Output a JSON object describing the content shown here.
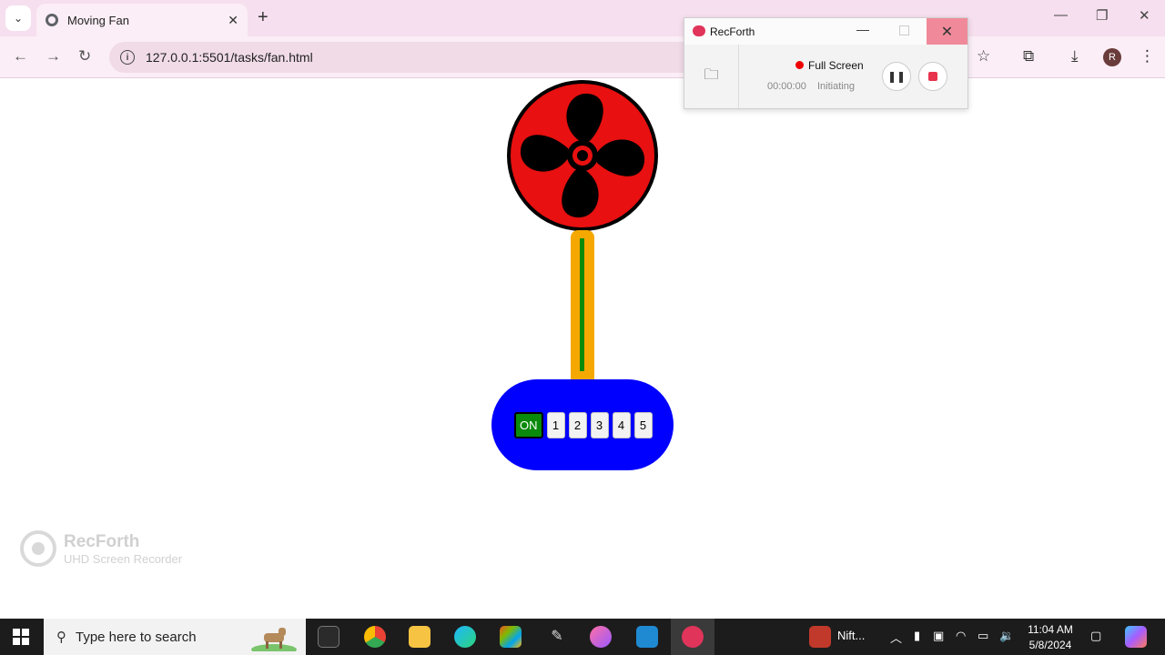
{
  "browser": {
    "tab_title": "Moving Fan",
    "url": "127.0.0.1:5501/tasks/fan.html",
    "profile_initial": "R"
  },
  "fan": {
    "buttons": [
      "ON",
      "1",
      "2",
      "3",
      "4",
      "5"
    ],
    "colors": {
      "blade_bg": "#e81010",
      "pole": "#f5a800",
      "pole_line": "#0a8a0a",
      "base": "#0000ff",
      "on_button": "#0a8a0a"
    }
  },
  "watermark": {
    "brand": "RecForth",
    "tagline": "UHD Screen Recorder"
  },
  "recorder": {
    "app_name": "RecForth",
    "mode": "Full Screen",
    "time": "00:00:00",
    "status": "Initiating"
  },
  "taskbar": {
    "search_placeholder": "Type here to search",
    "tray_app": "Nift...",
    "time": "11:04 AM",
    "date": "5/8/2024"
  }
}
